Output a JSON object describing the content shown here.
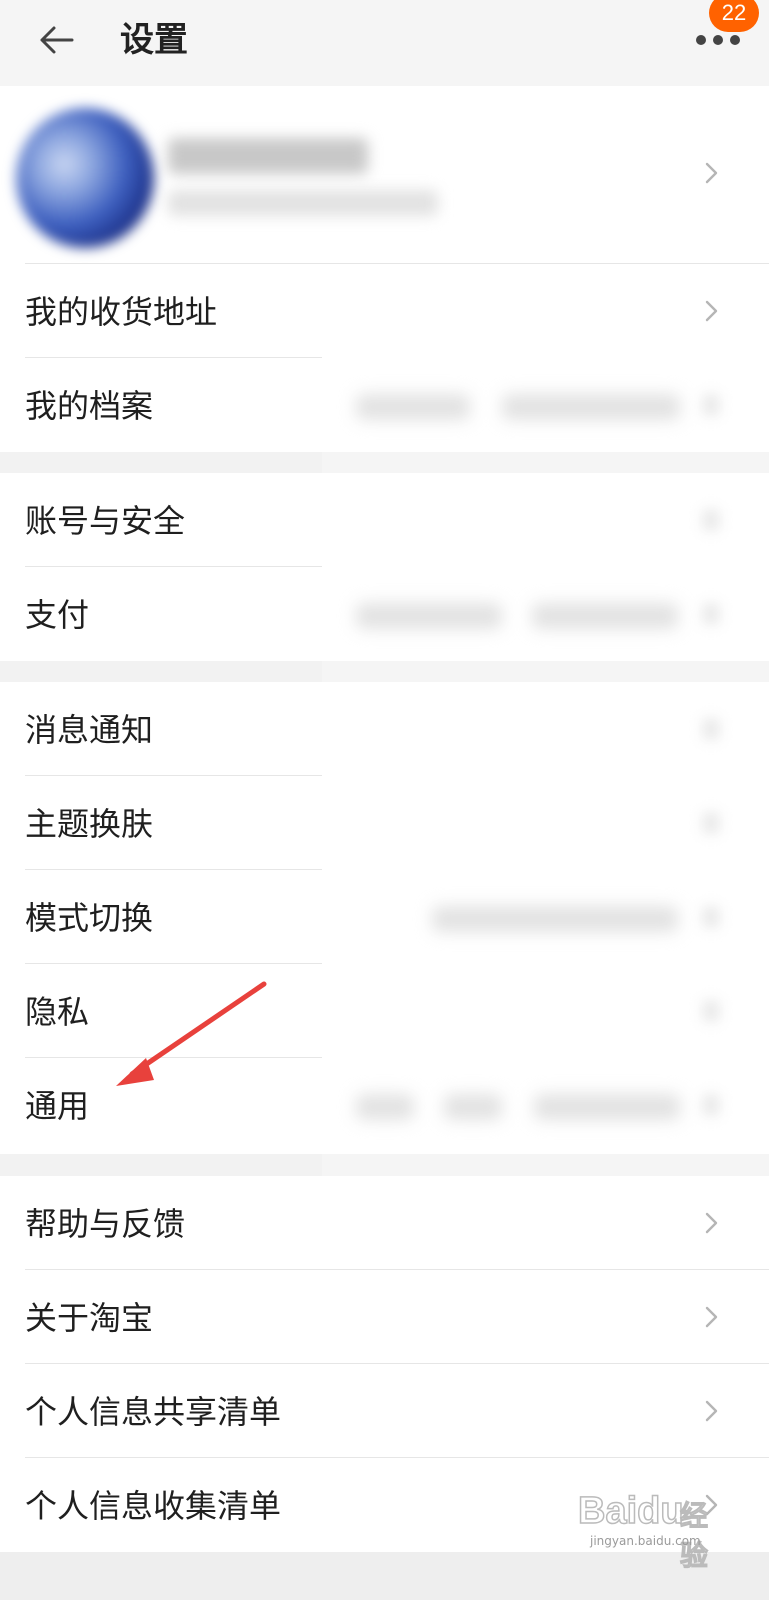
{
  "header": {
    "title": "设置",
    "badge_count": "22",
    "back_icon": "arrow-left-icon",
    "more_icon": "more-dots-icon"
  },
  "sections": [
    {
      "rows": [
        {
          "label": "我的收货地址"
        },
        {
          "label": "我的档案"
        }
      ]
    },
    {
      "rows": [
        {
          "label": "账号与安全"
        },
        {
          "label": "支付"
        }
      ]
    },
    {
      "rows": [
        {
          "label": "消息通知"
        },
        {
          "label": "主题换肤"
        },
        {
          "label": "模式切换"
        },
        {
          "label": "隐私"
        },
        {
          "label": "通用"
        }
      ]
    },
    {
      "rows": [
        {
          "label": "帮助与反馈"
        },
        {
          "label": "关于淘宝"
        },
        {
          "label": "个人信息共享清单"
        },
        {
          "label": "个人信息收集清单"
        }
      ]
    }
  ],
  "watermark": {
    "brand": "Bai",
    "brand_suffix": "du",
    "cn": "经验",
    "url": "jingyan.baidu.com"
  },
  "colors": {
    "accent": "#ff6200",
    "annotation_arrow": "#e8413c",
    "background": "#f2f2f2"
  }
}
